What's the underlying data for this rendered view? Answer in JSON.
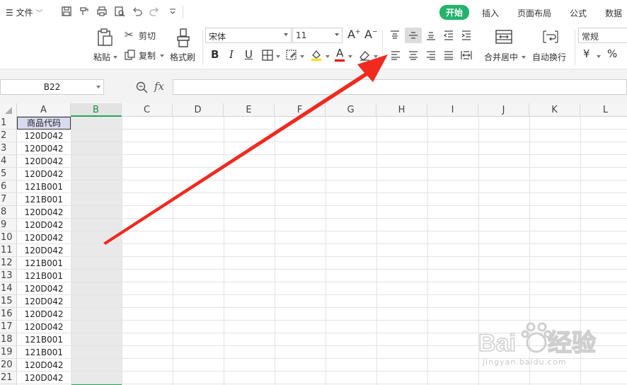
{
  "menubar": {
    "file_label": "文件",
    "tabs": [
      {
        "label": "开始",
        "active": true
      },
      {
        "label": "插入",
        "active": false
      },
      {
        "label": "页面布局",
        "active": false
      },
      {
        "label": "公式",
        "active": false
      },
      {
        "label": "数据",
        "active": false
      }
    ],
    "accent_color": "#23b36b"
  },
  "ribbon": {
    "paste_label": "粘贴",
    "cut_label": "剪切",
    "copy_label": "复制",
    "format_painter_label": "格式刷",
    "font_name": "宋体",
    "font_size": "11",
    "bold_label": "B",
    "italic_label": "I",
    "underline_label": "U",
    "font_color_label": "A",
    "merge_center_label": "合并居中",
    "wrap_text_label": "自动换行",
    "number_format": "常规",
    "currency_label": "¥",
    "percent_label": "%"
  },
  "formula_bar": {
    "name_box": "B22",
    "fx_label": "fx",
    "formula_value": ""
  },
  "sheet": {
    "columns": [
      "A",
      "B",
      "C",
      "D",
      "E",
      "F",
      "G",
      "H",
      "I",
      "J",
      "K",
      "L"
    ],
    "selected_column": "B",
    "row_numbers": [
      "1",
      "2",
      "3",
      "4",
      "5",
      "6",
      "7",
      "8",
      "9",
      "10",
      "11",
      "12",
      "13",
      "14",
      "15",
      "16",
      "17",
      "18",
      "19",
      "20",
      "21"
    ],
    "column_a": [
      "商品代码",
      "120D042",
      "120D042",
      "120D042",
      "120D042",
      "121B001",
      "121B001",
      "120D042",
      "120D042",
      "120D042",
      "120D042",
      "121B001",
      "121B001",
      "120D042",
      "120D042",
      "120D042",
      "120D042",
      "121B001",
      "121B001",
      "120D042",
      "120D042"
    ]
  },
  "annotation": {
    "arrow_color": "#f02a1e"
  },
  "watermark": {
    "brand": "Baidu经验",
    "url": "jingyan.baidu.com"
  }
}
